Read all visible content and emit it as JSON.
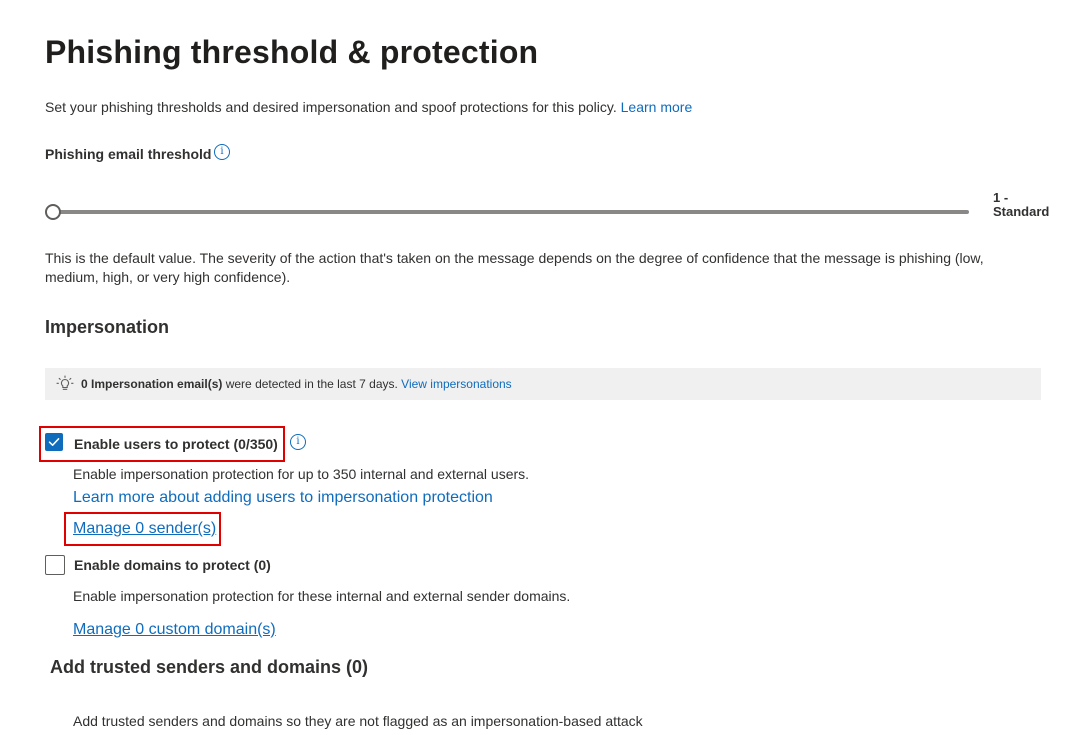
{
  "header": {
    "title": "Phishing threshold & protection",
    "description": "Set your phishing thresholds and desired impersonation and spoof protections for this policy.",
    "learn_more": "Learn more"
  },
  "threshold": {
    "label": "Phishing email threshold",
    "value_text": "1 - Standard",
    "value_level": 1,
    "explanation": "This is the default value. The severity of the action that's taken on the message depends on the degree of confidence that the message is phishing (low, medium, high, or very high confidence)."
  },
  "impersonation": {
    "heading": "Impersonation",
    "banner": {
      "bold": "0 Impersonation email(s)",
      "text": "were detected in the last 7 days.",
      "link": "View impersonations"
    },
    "users": {
      "label": "Enable users to protect (0/350)",
      "checked": true,
      "description": "Enable impersonation protection for up to 350 internal and external users.",
      "learn_link": "Learn more about adding users to impersonation protection",
      "manage_link": "Manage 0 sender(s)"
    },
    "domains": {
      "label": "Enable domains to protect (0)",
      "checked": false,
      "description": "Enable impersonation protection for these internal and external sender domains.",
      "manage_link": "Manage 0 custom domain(s)"
    }
  },
  "trusted": {
    "heading": "Add trusted senders and domains (0)",
    "description": "Add trusted senders and domains so they are not flagged as an impersonation-based attack"
  },
  "colors": {
    "accent": "#0f6cbd",
    "highlight": "#e10000",
    "banner_bg": "#f0f0f0"
  }
}
